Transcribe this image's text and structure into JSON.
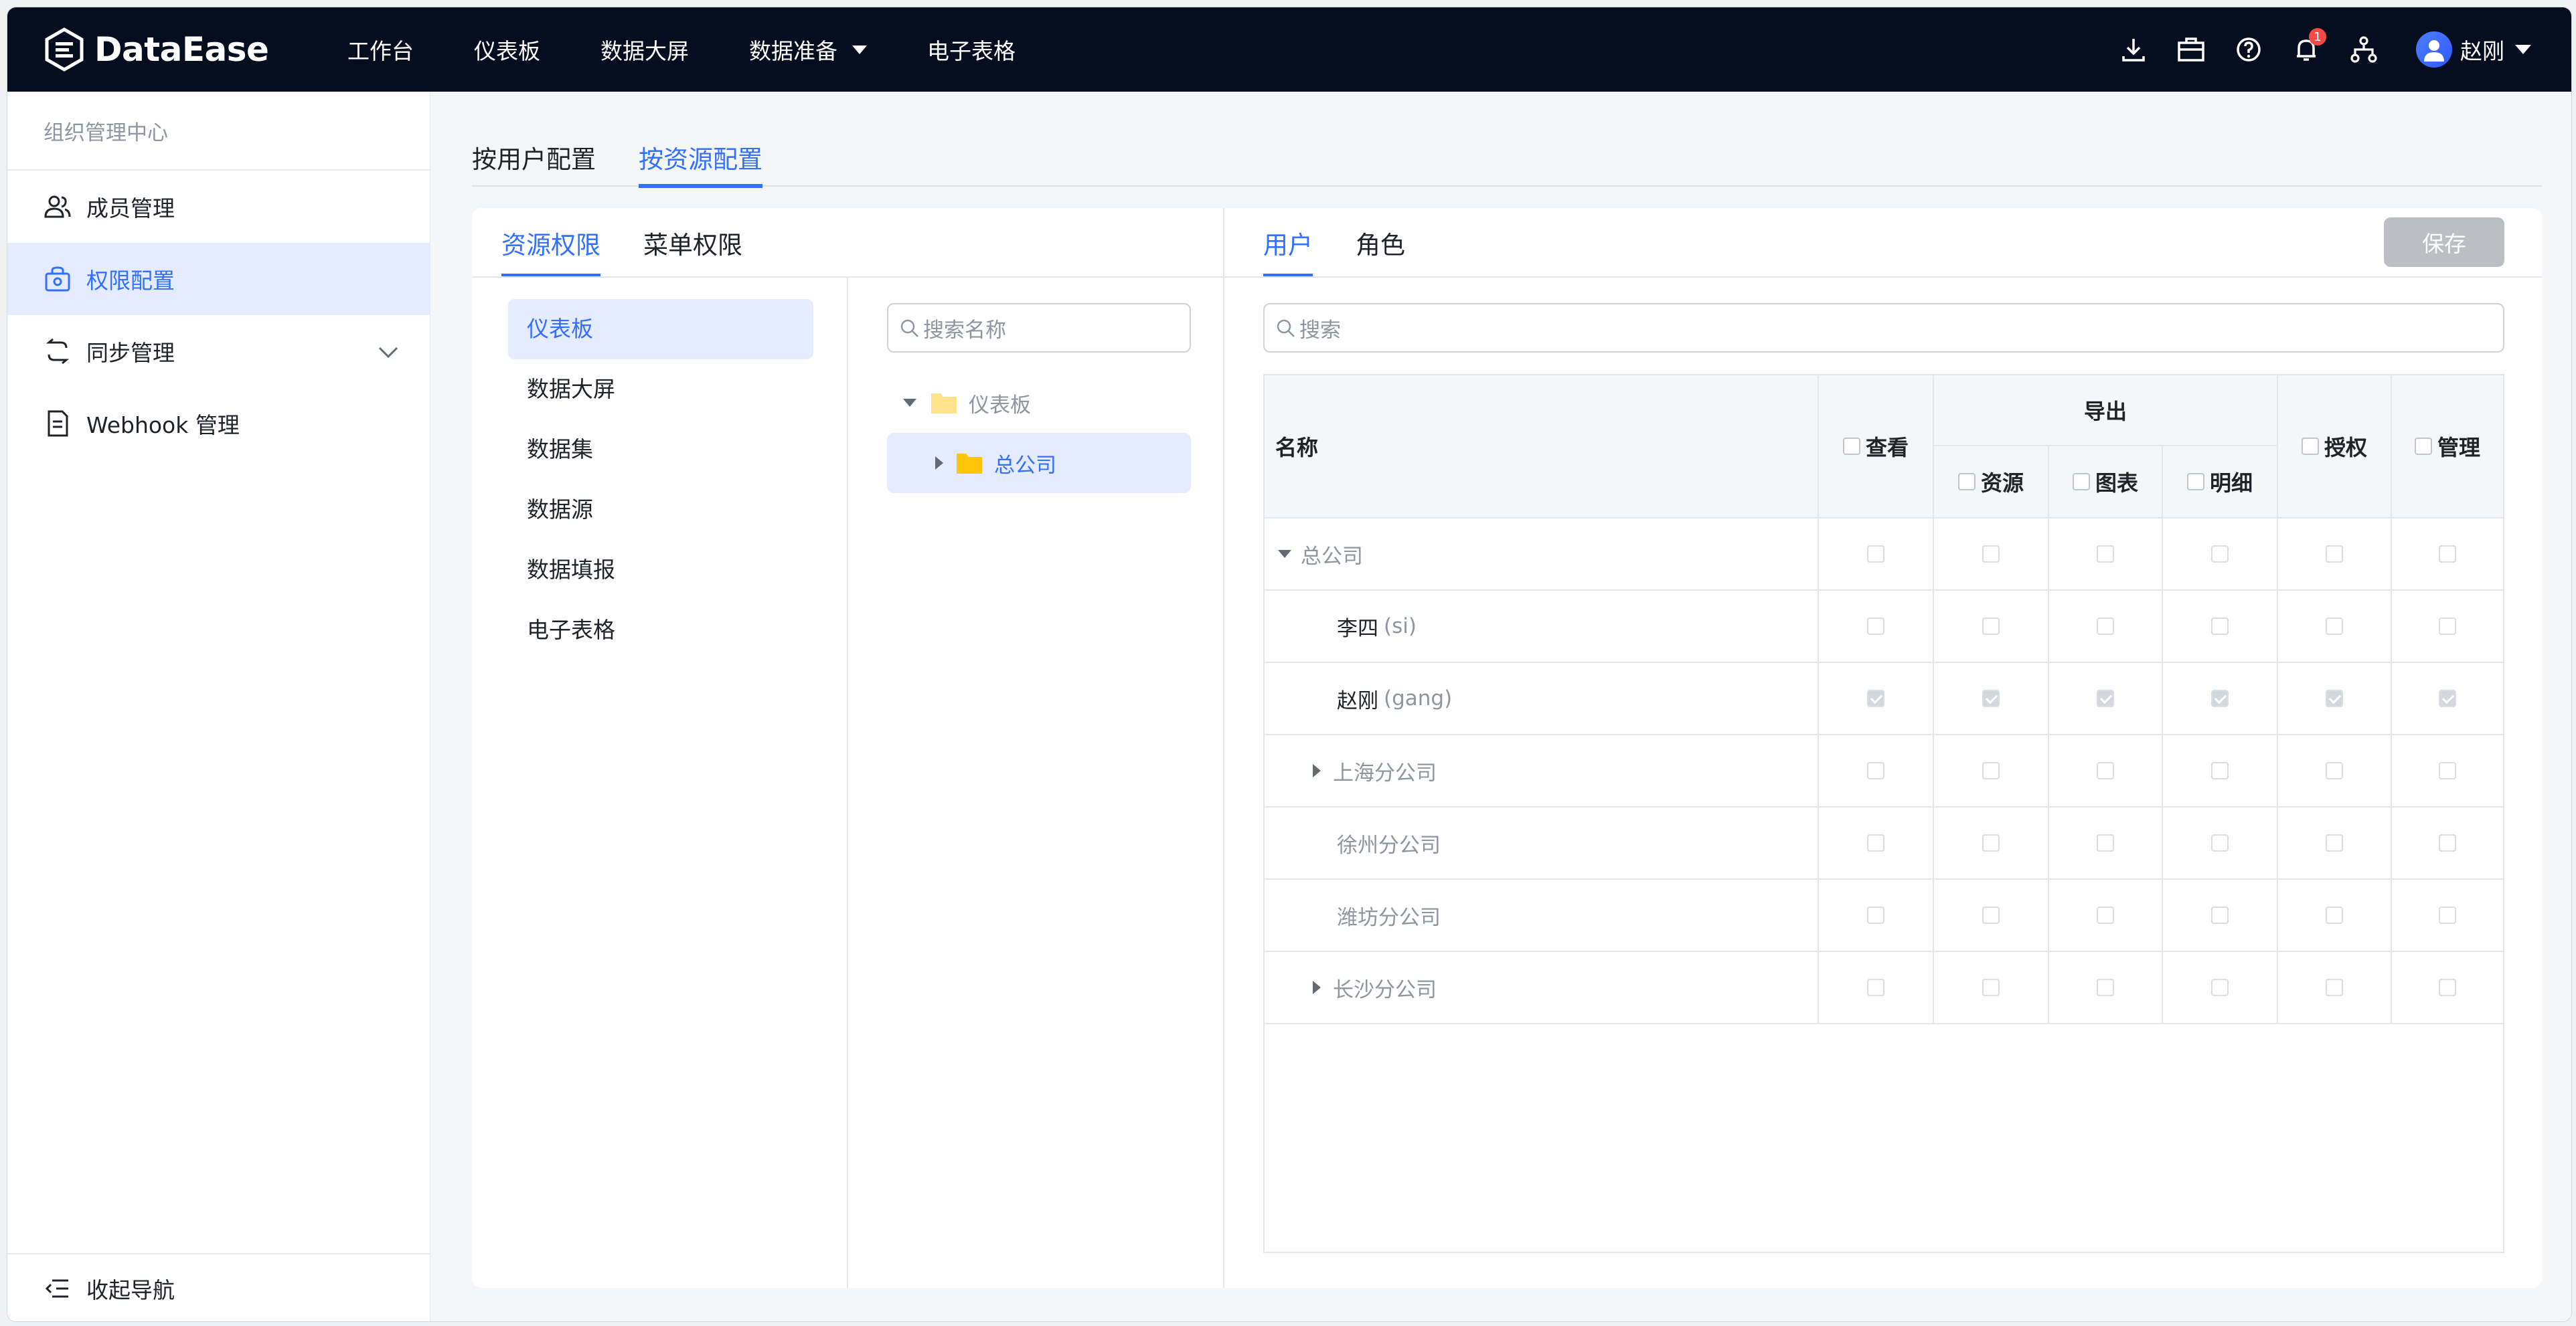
{
  "app": {
    "logo_text": "DataEase"
  },
  "nav": {
    "items": [
      {
        "label": "工作台"
      },
      {
        "label": "仪表板"
      },
      {
        "label": "数据大屏"
      },
      {
        "label": "数据准备"
      },
      {
        "label": "电子表格"
      }
    ]
  },
  "topbar": {
    "notification_count": "1",
    "user_name": "赵刚"
  },
  "sidebar": {
    "header": "组织管理中心",
    "items": [
      {
        "label": "成员管理"
      },
      {
        "label": "权限配置"
      },
      {
        "label": "同步管理"
      },
      {
        "label": "Webhook 管理"
      }
    ],
    "footer": "收起导航"
  },
  "tabs": {
    "by_user": "按用户配置",
    "by_resource": "按资源配置"
  },
  "subtabs": {
    "resource_perm": "资源权限",
    "menu_perm": "菜单权限",
    "user": "用户",
    "role": "角色"
  },
  "save_label": "保存",
  "resource_types": [
    "仪表板",
    "数据大屏",
    "数据集",
    "数据源",
    "数据填报",
    "电子表格"
  ],
  "resource_search_placeholder": "搜索名称",
  "tree": {
    "root": "仪表板",
    "child": "总公司"
  },
  "user_search_placeholder": "搜索",
  "table": {
    "headers": {
      "name": "名称",
      "view": "查看",
      "export": "导出",
      "export_resource": "资源",
      "export_chart": "图表",
      "export_detail": "明细",
      "authorize": "授权",
      "manage": "管理"
    },
    "rows": [
      {
        "name": "总公司",
        "sub": "",
        "type": "group-open",
        "checked": false
      },
      {
        "name": "李四",
        "sub": "(si)",
        "type": "user",
        "checked": false
      },
      {
        "name": "赵刚",
        "sub": "(gang)",
        "type": "user",
        "checked": true
      },
      {
        "name": "上海分公司",
        "sub": "",
        "type": "group-closed",
        "checked": false
      },
      {
        "name": "徐州分公司",
        "sub": "",
        "type": "group",
        "checked": false
      },
      {
        "name": "潍坊分公司",
        "sub": "",
        "type": "group",
        "checked": false
      },
      {
        "name": "长沙分公司",
        "sub": "",
        "type": "group-closed",
        "checked": false
      }
    ]
  }
}
